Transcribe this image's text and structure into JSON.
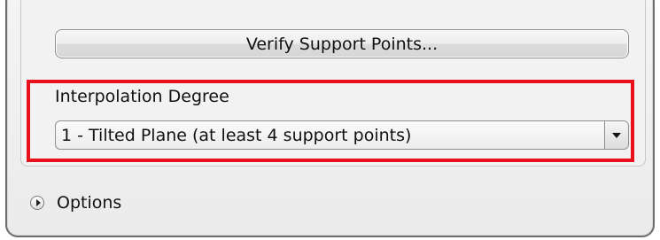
{
  "verify_button": {
    "label": "Verify Support Points..."
  },
  "interpolation": {
    "label": "Interpolation Degree",
    "selected_value": "1 - Tilted Plane (at least 4 support points)"
  },
  "options": {
    "label": "Options",
    "icon": "expand-arrow-icon"
  },
  "highlight": {
    "color": "#e8101a"
  }
}
